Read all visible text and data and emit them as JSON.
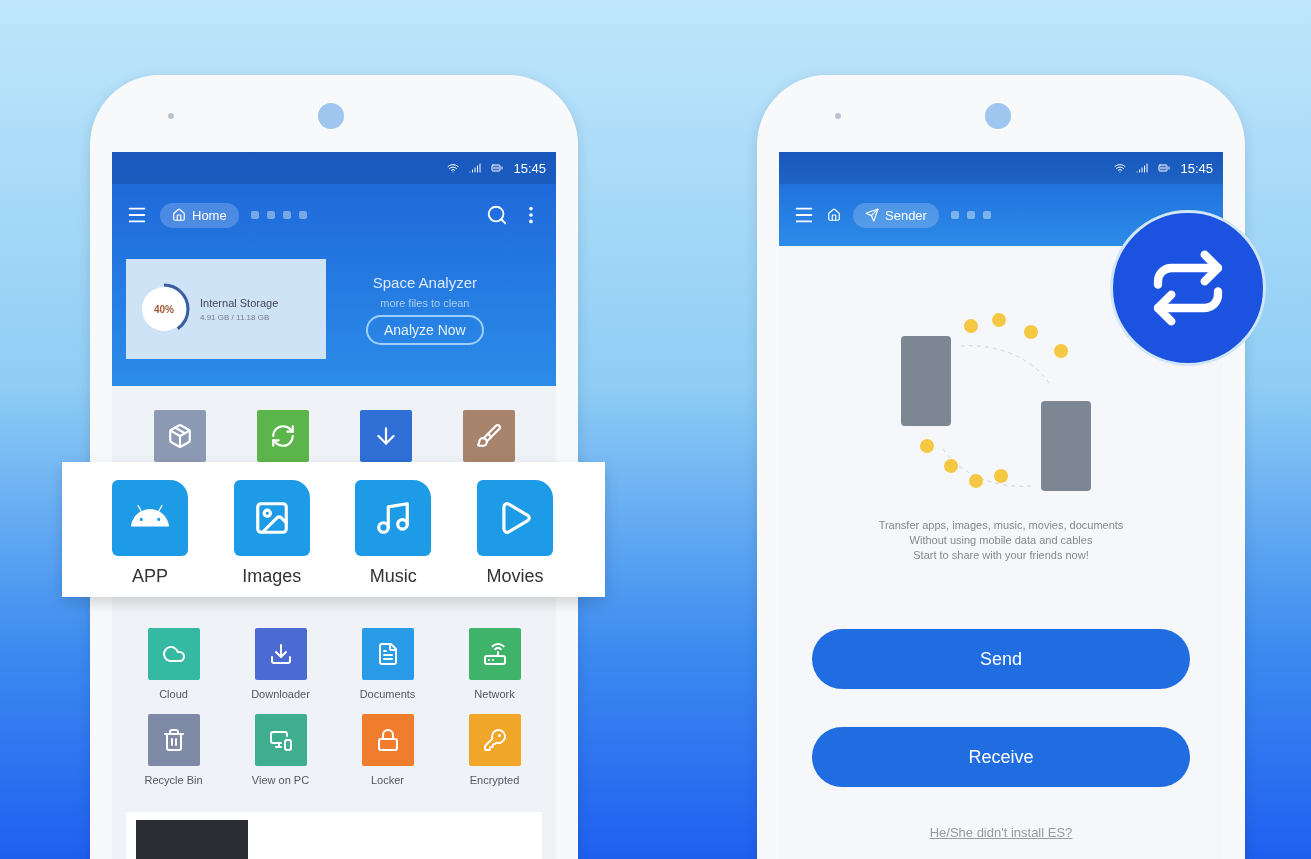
{
  "left_phone": {
    "status_time": "15:45",
    "breadcrumb": "Home",
    "storage": {
      "percent": "40%",
      "level": 0.4,
      "title": "Internal Storage",
      "detail": "4.91 GB / 11.18 GB"
    },
    "analyzer": {
      "title": "Space Analyzer",
      "subtitle": "more files to clean",
      "button": "Analyze Now"
    },
    "top_tiles": [
      {
        "kind": "box",
        "color": "#8d9ab3"
      },
      {
        "kind": "refresh",
        "color": "#5cb54a"
      },
      {
        "kind": "arrow",
        "color": "#2f6fd6"
      },
      {
        "kind": "broom",
        "color": "#a8846c"
      }
    ],
    "featured": [
      {
        "kind": "android",
        "label": "APP"
      },
      {
        "kind": "image",
        "label": "Images"
      },
      {
        "kind": "music",
        "label": "Music"
      },
      {
        "kind": "movie",
        "label": "Movies"
      }
    ],
    "tools": [
      {
        "kind": "cloud",
        "label": "Cloud",
        "color": "#35b9a3"
      },
      {
        "kind": "download",
        "label": "Downloader",
        "color": "#4b6bd3"
      },
      {
        "kind": "document",
        "label": "Documents",
        "color": "#2a9be6"
      },
      {
        "kind": "network",
        "label": "Network",
        "color": "#3fb36a"
      },
      {
        "kind": "trash",
        "label": "Recycle Bin",
        "color": "#7f8aa6"
      },
      {
        "kind": "pc",
        "label": "View on PC",
        "color": "#3fae8e"
      },
      {
        "kind": "lock",
        "label": "Locker",
        "color": "#f07d2e"
      },
      {
        "kind": "key",
        "label": "Encrypted",
        "color": "#f0a628"
      }
    ]
  },
  "right_phone": {
    "status_time": "15:45",
    "breadcrumb": "Sender",
    "message": [
      "Transfer apps, images, music, movies, documents",
      "Without using mobile data and cables",
      "Start to share with your friends now!"
    ],
    "buttons": [
      "Send",
      "Receive"
    ],
    "link": "He/She didn't install ES?"
  }
}
